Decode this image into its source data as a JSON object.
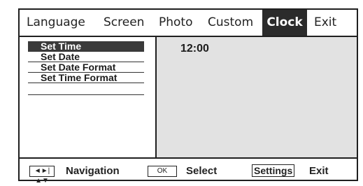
{
  "tabs": [
    {
      "label": "Language",
      "active": false
    },
    {
      "label": "Screen",
      "active": false
    },
    {
      "label": "Photo",
      "active": false
    },
    {
      "label": "Custom",
      "active": false
    },
    {
      "label": "Clock",
      "active": true
    },
    {
      "label": "Exit",
      "active": false
    }
  ],
  "menu": {
    "items": [
      {
        "label": "Set Time",
        "selected": true
      },
      {
        "label": "Set Date",
        "selected": false
      },
      {
        "label": "Set Date Format",
        "selected": false
      },
      {
        "label": "Set Time Format",
        "selected": false
      }
    ]
  },
  "panel": {
    "time_value": "12:00"
  },
  "footer": {
    "nav_key": "◄►|▲▼",
    "nav_label": "Navigation",
    "ok_key": "OK",
    "ok_label": "Select",
    "settings_key": "Settings",
    "settings_label": "Exit"
  },
  "colors": {
    "active_tab_bg": "#2b2b2b",
    "selected_item_bg": "#3a3a3a",
    "panel_bg": "#e2e2e2",
    "border": "#1f1f1f"
  }
}
